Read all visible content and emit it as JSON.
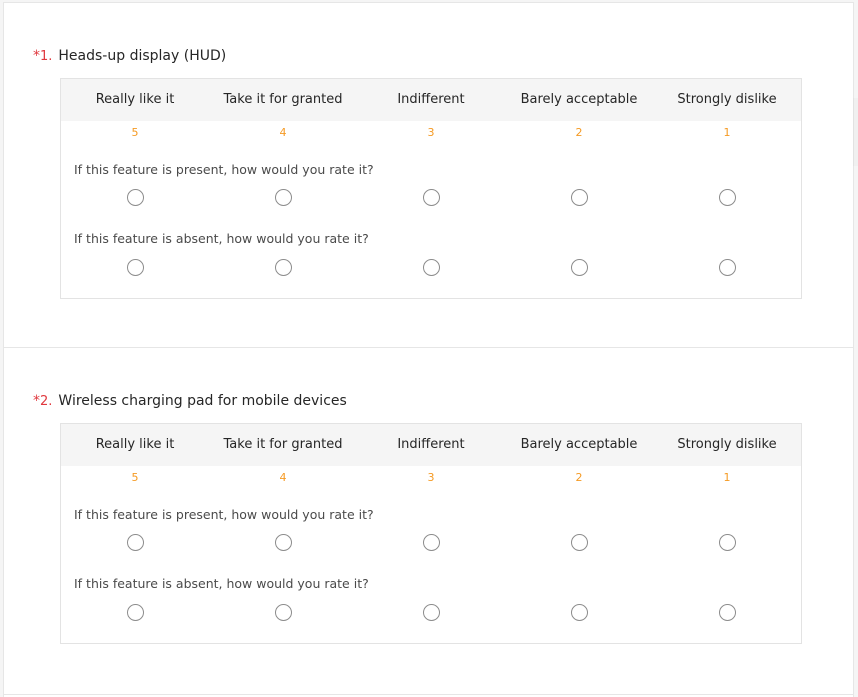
{
  "questions": [
    {
      "required_mark": "*",
      "number": "1.",
      "title": "Heads-up display (HUD)",
      "options": [
        {
          "label": "Really like it",
          "score": "5"
        },
        {
          "label": "Take it for granted",
          "score": "4"
        },
        {
          "label": "Indifferent",
          "score": "3"
        },
        {
          "label": "Barely acceptable",
          "score": "2"
        },
        {
          "label": "Strongly dislike",
          "score": "1"
        }
      ],
      "present_prompt": "If this feature is present, how would you rate it?",
      "absent_prompt": "If this feature is absent, how would you rate it?"
    },
    {
      "required_mark": "*",
      "number": "2.",
      "title": "Wireless charging pad for mobile devices",
      "options": [
        {
          "label": "Really like it",
          "score": "5"
        },
        {
          "label": "Take it for granted",
          "score": "4"
        },
        {
          "label": "Indifferent",
          "score": "3"
        },
        {
          "label": "Barely acceptable",
          "score": "2"
        },
        {
          "label": "Strongly dislike",
          "score": "1"
        }
      ],
      "present_prompt": "If this feature is present, how would you rate it?",
      "absent_prompt": "If this feature is absent, how would you rate it?"
    }
  ],
  "colors": {
    "required": "#e0383e",
    "score": "#f59a23",
    "header_bg": "#f5f5f5"
  }
}
